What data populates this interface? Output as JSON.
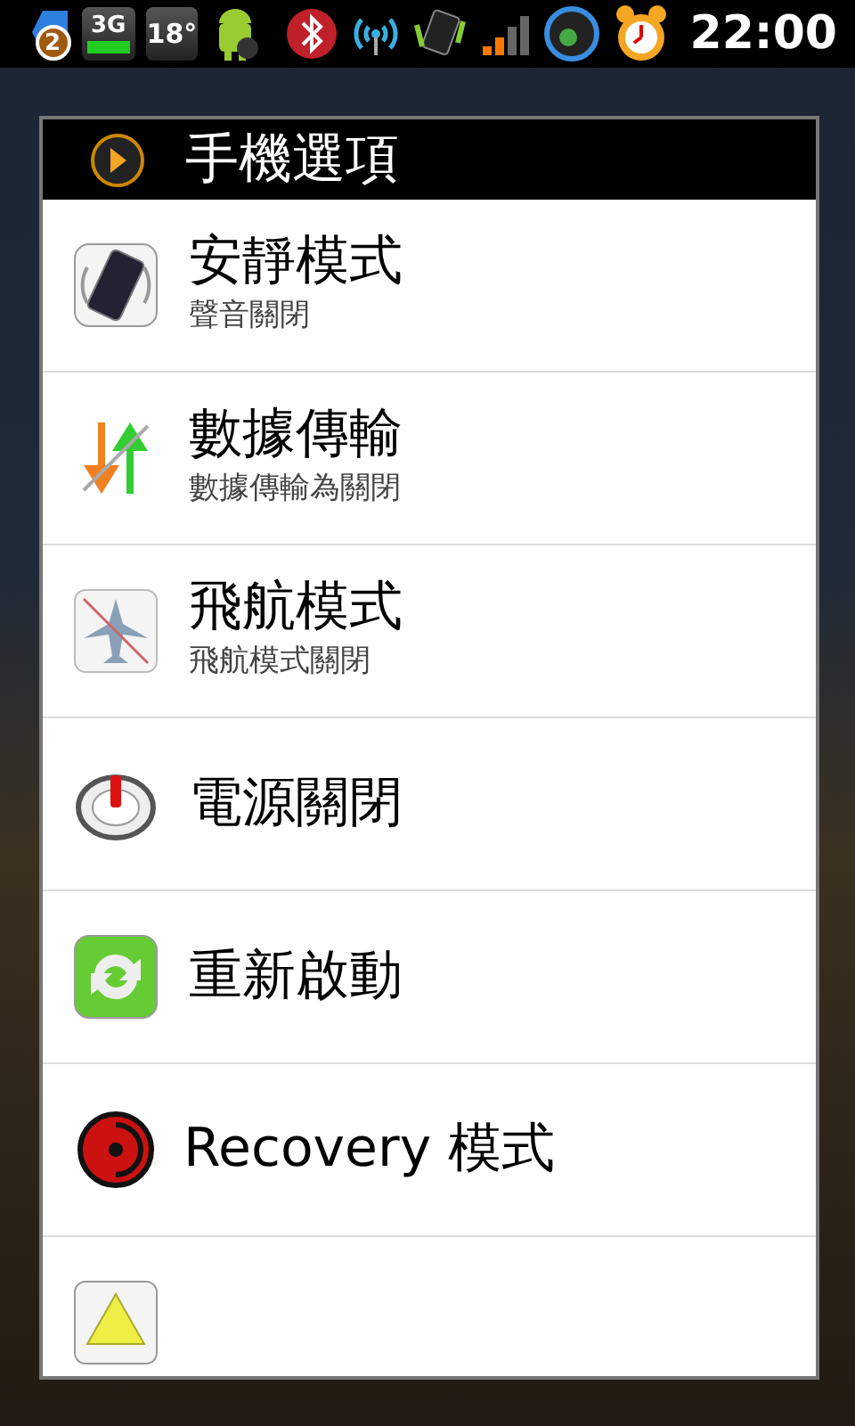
{
  "status_bar": {
    "notification_count": "2",
    "network": "3G",
    "temperature": "18°",
    "time": "22:00"
  },
  "dialog": {
    "title": "手機選項",
    "items": [
      {
        "kind": "silent",
        "title": "安靜模式",
        "subtitle": "聲音關閉"
      },
      {
        "kind": "data",
        "title": "數據傳輸",
        "subtitle": "數據傳輸為關閉"
      },
      {
        "kind": "airplane",
        "title": "飛航模式",
        "subtitle": "飛航模式關閉"
      },
      {
        "kind": "power",
        "title": "電源關閉"
      },
      {
        "kind": "reboot",
        "title": "重新啟動"
      },
      {
        "kind": "recovery",
        "title": "Recovery 模式"
      },
      {
        "kind": "download"
      }
    ]
  }
}
